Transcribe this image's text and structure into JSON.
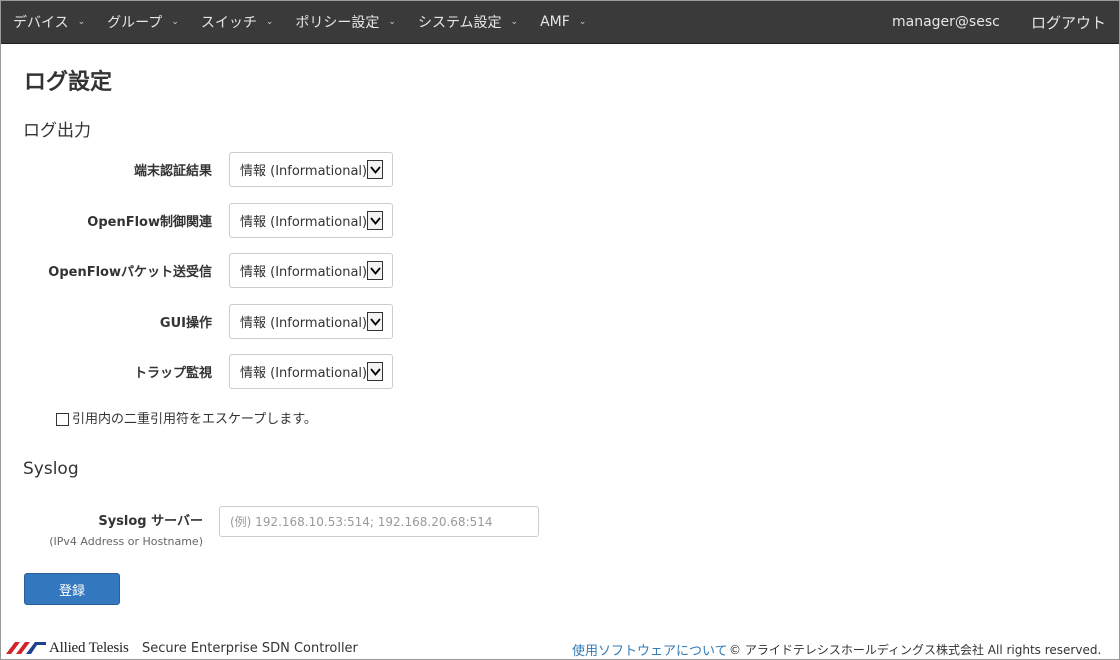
{
  "nav": {
    "items": [
      {
        "label": "デバイス"
      },
      {
        "label": "グループ"
      },
      {
        "label": "スイッチ"
      },
      {
        "label": "ポリシー設定"
      },
      {
        "label": "システム設定"
      },
      {
        "label": "AMF"
      }
    ],
    "user": "manager@sesc",
    "logout": "ログアウト"
  },
  "page": {
    "title": "ログ設定"
  },
  "log_output": {
    "section_title": "ログ出力",
    "rows": [
      {
        "label": "端末認証結果",
        "value": "情報 (Informational)"
      },
      {
        "label": "OpenFlow制御関連",
        "value": "情報 (Informational)"
      },
      {
        "label": "OpenFlowパケット送受信",
        "value": "情報 (Informational)"
      },
      {
        "label": "GUI操作",
        "value": "情報 (Informational)"
      },
      {
        "label": "トラップ監視",
        "value": "情報 (Informational)"
      }
    ],
    "escape_checkbox": {
      "label": "引用内の二重引用符をエスケープします。",
      "checked": false
    }
  },
  "syslog": {
    "section_title": "Syslog",
    "server_label": "Syslog サーバー",
    "server_sublabel": "(IPv4 Address or Hostname)",
    "server_value": "",
    "server_placeholder": "(例) 192.168.10.53:514; 192.168.20.68:514"
  },
  "actions": {
    "submit_label": "登録"
  },
  "footer": {
    "brand": "Allied Telesis",
    "product": "Secure Enterprise SDN Controller",
    "software_link": "使用ソフトウェアについて",
    "copyright": "© アライドテレシスホールディングス株式会社 All rights reserved."
  },
  "colors": {
    "navbar_bg": "#3a3a3a",
    "primary_button": "#3478bf",
    "link": "#337ab7",
    "logo_red": "#d2232a"
  }
}
